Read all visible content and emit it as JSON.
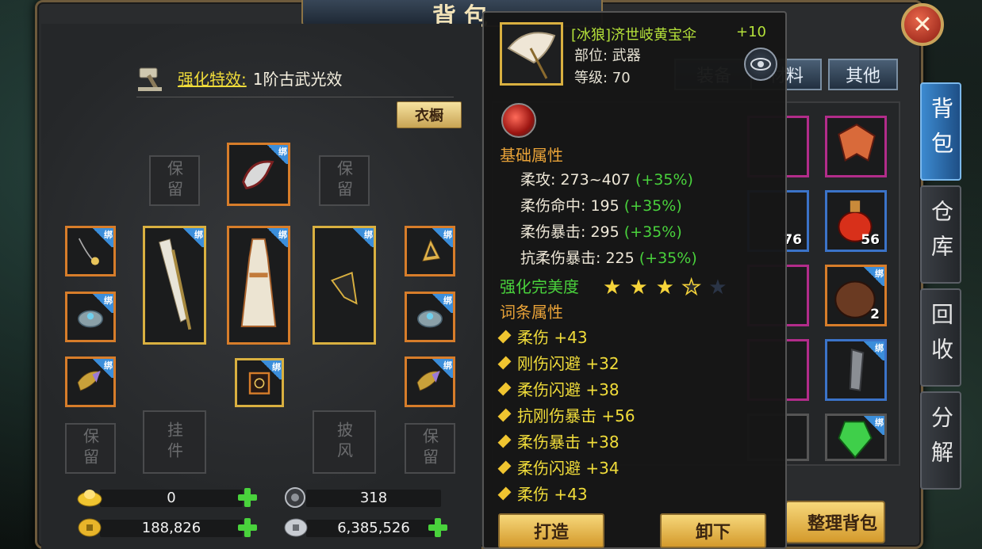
{
  "window": {
    "title": "背包"
  },
  "equipment": {
    "enhance_label": "强化特效:",
    "enhance_value": "1阶古武光效",
    "wardrobe_button": "衣橱",
    "reserved": "保留",
    "pendant": "挂件",
    "cape": "披风",
    "bind_badge": "绑"
  },
  "currency": {
    "gold_ingot": "0",
    "gold_coin": "188,826",
    "token": "318",
    "silver": "6,385,526"
  },
  "inventory": {
    "tabs": {
      "equipment": "装备",
      "material": "材料",
      "other": "其他"
    },
    "counts": {
      "potion": "56",
      "jar": "2",
      "partial": "76"
    },
    "sort_button": "整理背包"
  },
  "side_tabs": {
    "bag": "背包",
    "warehouse": "仓库",
    "recycle": "回收",
    "decompose": "分解"
  },
  "tooltip": {
    "name": "[冰狼]济世岐黄宝伞",
    "plus": "+10",
    "slot": "部位: 武器",
    "level": "等级: 70",
    "base_title": "基础属性",
    "base_attrs": [
      {
        "text": "柔攻: 273~407 ",
        "bonus": "(+35%)"
      },
      {
        "text": "柔伤命中: 195 ",
        "bonus": "(+35%)"
      },
      {
        "text": "柔伤暴击: 295 ",
        "bonus": "(+35%)"
      },
      {
        "text": "抗柔伤暴击: 225 ",
        "bonus": "(+35%)"
      }
    ],
    "perfection_title": "强化完美度",
    "perfection_stars": "3 of 5",
    "affix_title": "词条属性",
    "affixes": [
      "柔伤 +43",
      "刚伤闪避 +32",
      "柔伤闪避 +38",
      "抗刚伤暴击 +56",
      "柔伤暴击 +38",
      "柔伤闪避 +34",
      "柔伤 +43"
    ],
    "forge_button": "打造",
    "unequip_button": "卸下"
  },
  "colors": {
    "accent_gold": "#d9b040",
    "bonus_green": "#49d23c",
    "affix_yellow": "#f0dc3a",
    "section_orange": "#e8a238",
    "active_tab_blue": "#3c8ad0"
  }
}
